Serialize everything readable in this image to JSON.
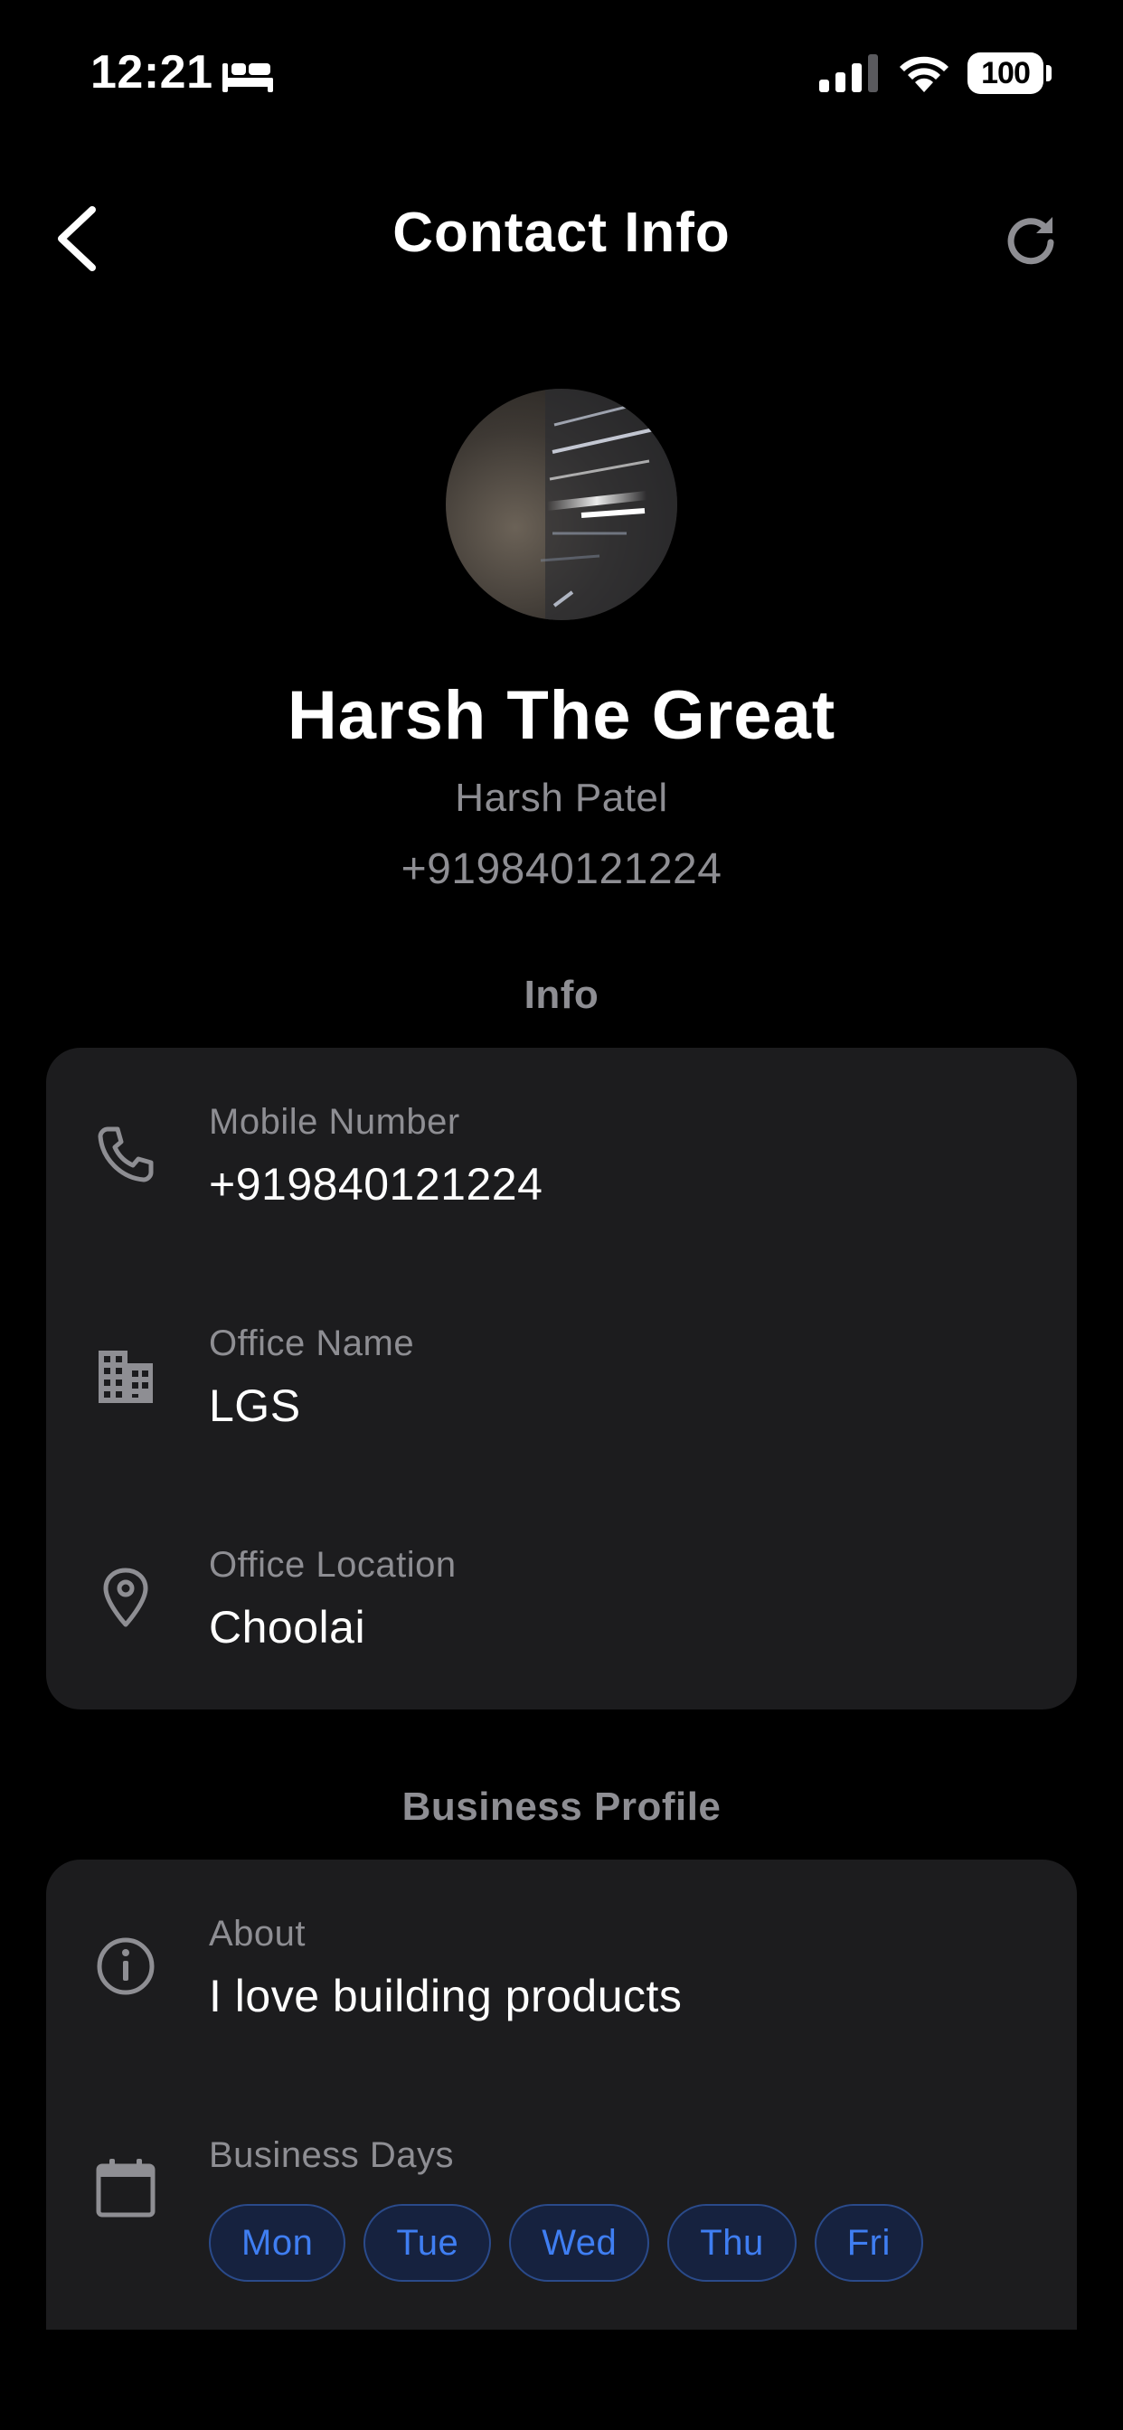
{
  "status_bar": {
    "time": "12:21",
    "battery": "100"
  },
  "nav": {
    "title": "Contact Info",
    "back_icon": "chevron-left-icon",
    "refresh_icon": "refresh-icon"
  },
  "profile": {
    "display_name": "Harsh The Great",
    "full_name": "Harsh Patel",
    "phone": "+919840121224"
  },
  "info_section": {
    "title": "Info",
    "rows": [
      {
        "icon": "phone-icon",
        "label": "Mobile Number",
        "value": "+919840121224"
      },
      {
        "icon": "building-icon",
        "label": "Office Name",
        "value": "LGS"
      },
      {
        "icon": "location-pin-icon",
        "label": "Office Location",
        "value": "Choolai"
      }
    ]
  },
  "business_section": {
    "title": "Business Profile",
    "about": {
      "icon": "info-icon",
      "label": "About",
      "value": "I love building products"
    },
    "days": {
      "icon": "calendar-icon",
      "label": "Business Days",
      "items": [
        "Mon",
        "Tue",
        "Wed",
        "Thu",
        "Fri"
      ]
    }
  },
  "colors": {
    "background": "#000000",
    "card": "#1c1c1e",
    "secondary_text": "#8e8e93",
    "chip_text": "#3f7ef2",
    "chip_bg": "#16223f",
    "chip_border": "#2a4a8a"
  }
}
